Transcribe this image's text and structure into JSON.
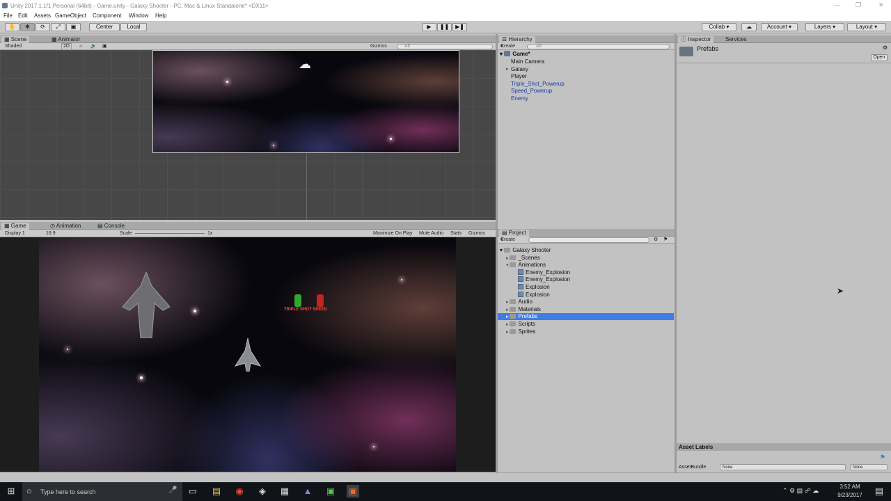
{
  "window": {
    "title": "Unity 2017.1.1f1 Personal (64bit) - Game.unity - Galaxy Shooter - PC, Mac & Linux Standalone* <DX11>"
  },
  "menu": [
    "File",
    "Edit",
    "Assets",
    "GameObject",
    "Component",
    "Window",
    "Help"
  ],
  "toolbar": {
    "pivot": "Center",
    "space": "Local",
    "collab": "Collab",
    "account": "Account",
    "layers": "Layers",
    "layout": "Layout"
  },
  "scene": {
    "tabs": [
      "Scene",
      "Animator"
    ],
    "shading": "Shaded",
    "mode_2d": "2D",
    "gizmos": "Gizmos",
    "search_placeholder": "All"
  },
  "game": {
    "tabs": [
      "Game",
      "Animation",
      "Console"
    ],
    "display": "Display 1",
    "aspect": "16:9",
    "scale_label": "Scale",
    "scale_value": "1x",
    "maximize": "Maximize On Play",
    "mute": "Mute Audio",
    "stats": "Stats",
    "gizmos": "Gizmos",
    "powerup_label": "TRIPLE SHOT SPEED"
  },
  "hierarchy": {
    "tab": "Hierarchy",
    "create": "Create",
    "search_placeholder": "All",
    "scene_name": "Game*",
    "items": [
      {
        "label": "Main Camera",
        "prefab": false,
        "expandable": false
      },
      {
        "label": "Galaxy",
        "prefab": false,
        "expandable": true
      },
      {
        "label": "Player",
        "prefab": false,
        "expandable": false
      },
      {
        "label": "Triple_Shot_Powerup",
        "prefab": true,
        "expandable": false
      },
      {
        "label": "Speed_Powerup",
        "prefab": true,
        "expandable": false
      },
      {
        "label": "Enemy",
        "prefab": true,
        "expandable": false
      }
    ]
  },
  "project": {
    "tab": "Project",
    "create": "Create",
    "root": "Galaxy Shooter",
    "items": [
      {
        "label": "_Scenes",
        "level": 1,
        "type": "folder"
      },
      {
        "label": "Animations",
        "level": 1,
        "type": "folder"
      },
      {
        "label": "Enemy_Explosion",
        "level": 2,
        "type": "anim"
      },
      {
        "label": "Enemy_Explosion",
        "level": 2,
        "type": "anim"
      },
      {
        "label": "Explosion",
        "level": 2,
        "type": "anim"
      },
      {
        "label": "Explosion",
        "level": 2,
        "type": "anim"
      },
      {
        "label": "Audio",
        "level": 1,
        "type": "folder"
      },
      {
        "label": "Materials",
        "level": 1,
        "type": "folder"
      },
      {
        "label": "Prefabs",
        "level": 1,
        "type": "folder",
        "selected": true
      },
      {
        "label": "Scripts",
        "level": 1,
        "type": "folder"
      },
      {
        "label": "Sprites",
        "level": 1,
        "type": "folder"
      }
    ]
  },
  "inspector": {
    "tabs": [
      "Inspector",
      "Services"
    ],
    "object_name": "Prefabs",
    "open_button": "Open",
    "asset_labels": "Asset Labels",
    "asset_bundle_label": "AssetBundle",
    "asset_bundle_value": "None",
    "asset_bundle_variant": "None"
  },
  "taskbar": {
    "search_placeholder": "Type here to search",
    "time": "3:52 AM",
    "date": "9/23/2017"
  },
  "colors": {
    "selection": "#3e7de2",
    "prefab_text": "#1a3fa8",
    "panel_bg": "#c2c2c2"
  }
}
